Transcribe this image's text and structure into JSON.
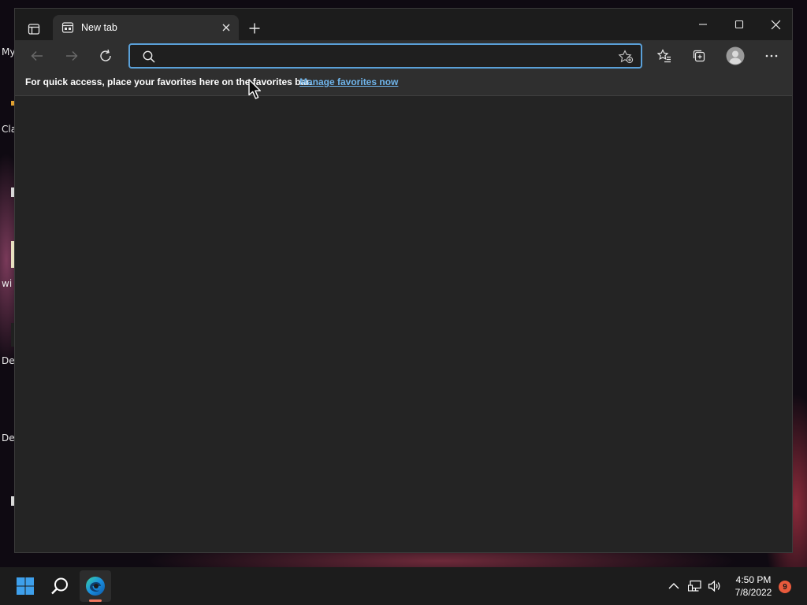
{
  "desktop": {
    "icon_labels": [
      "My",
      "Cla",
      "wi",
      "De",
      "De"
    ]
  },
  "browser": {
    "tab": {
      "title": "New tab",
      "favicon": "newtab-page-icon"
    },
    "tab_strip": {
      "new_tab_icon": "plus-icon",
      "tab_actions_icon": "tab-actions-icon"
    },
    "window_controls": [
      "minimize-icon",
      "maximize-icon",
      "close-icon"
    ],
    "toolbar": {
      "buttons": [
        "back-arrow-icon",
        "forward-arrow-icon",
        "refresh-icon",
        "favorites-icon",
        "collections-icon",
        "profile-avatar-icon",
        "more-menu-icon"
      ]
    },
    "address_bar": {
      "value": "",
      "placeholder": "",
      "search_icon": "search-icon",
      "add_favorite_icon": "star-add-icon"
    },
    "favorites_bar": {
      "message": "For quick access, place your favorites here on the favorites bar.",
      "link": "Manage favorites now"
    }
  },
  "taskbar": {
    "pinned": [
      "windows-start-icon",
      "search-icon",
      "edge-browser-icon"
    ],
    "tray": [
      "chevron-up-icon",
      "network-icon",
      "volume-icon"
    ],
    "clock": {
      "time": "4:50 PM",
      "date": "7/8/2022"
    },
    "notification_count": "9"
  },
  "colors": {
    "accent": "#5aa0d8",
    "link": "#6fb4ea",
    "window_bg": "#242424",
    "toolbar_bg": "#2f2f2f",
    "taskbar_bg": "#1c1c1c",
    "badge": "#e85a3c"
  }
}
